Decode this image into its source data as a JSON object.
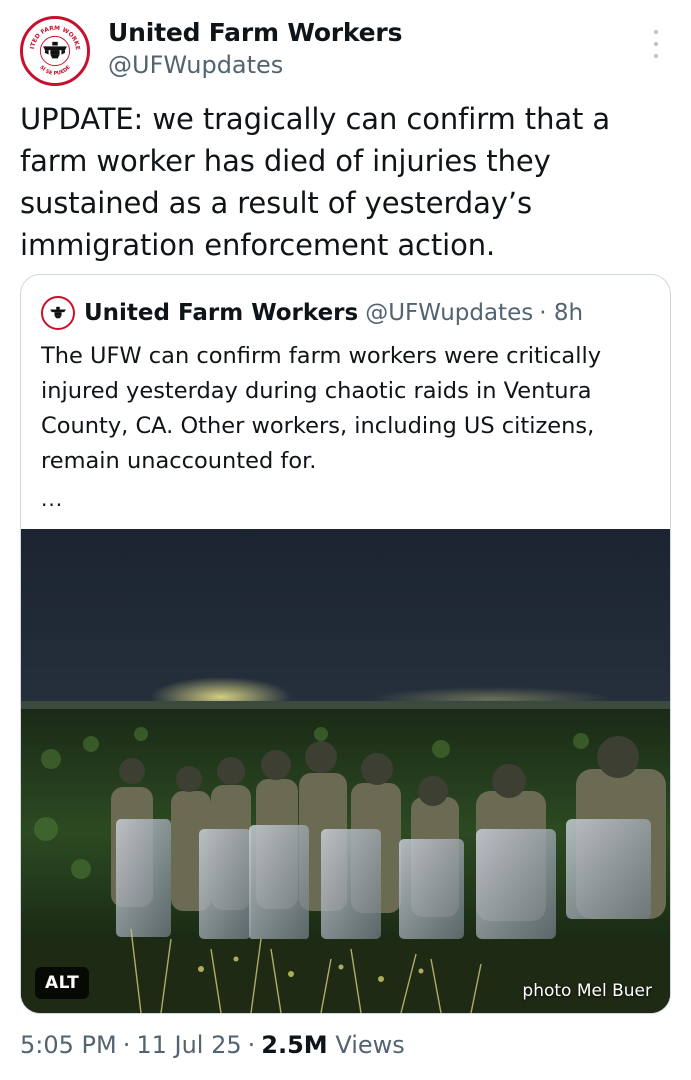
{
  "author": {
    "name": "United Farm Workers",
    "handle": "@UFWupdates",
    "avatar_ring_text": "UNITED FARM WORKERS",
    "avatar_bottom_text": "SÍ SE PUEDE"
  },
  "tweet": {
    "text": "UPDATE: we tragically can confirm that a farm worker has died of injuries they sustained as a result of yesterday’s immigration enforcement action."
  },
  "quoted_tweet": {
    "name": "United Farm Workers",
    "handle": "@UFWupdates",
    "time": "· 8h",
    "text": "The UFW can confirm farm workers were critically injured yesterday during chaotic raids in Ventura County, CA. Other workers, including US citizens, remain unaccounted for.",
    "ellipsis": "...",
    "media": {
      "alt_label": "ALT",
      "photo_credit": "photo Mel Buer"
    }
  },
  "meta": {
    "time": "5:05 PM",
    "date": "11 Jul 25",
    "views_count": "2.5M",
    "views_label": "Views",
    "separator": "·"
  },
  "colors": {
    "brand_red": "#c8102e",
    "text_primary": "#0f1419",
    "text_secondary": "#536471",
    "border": "#cfd9de"
  }
}
